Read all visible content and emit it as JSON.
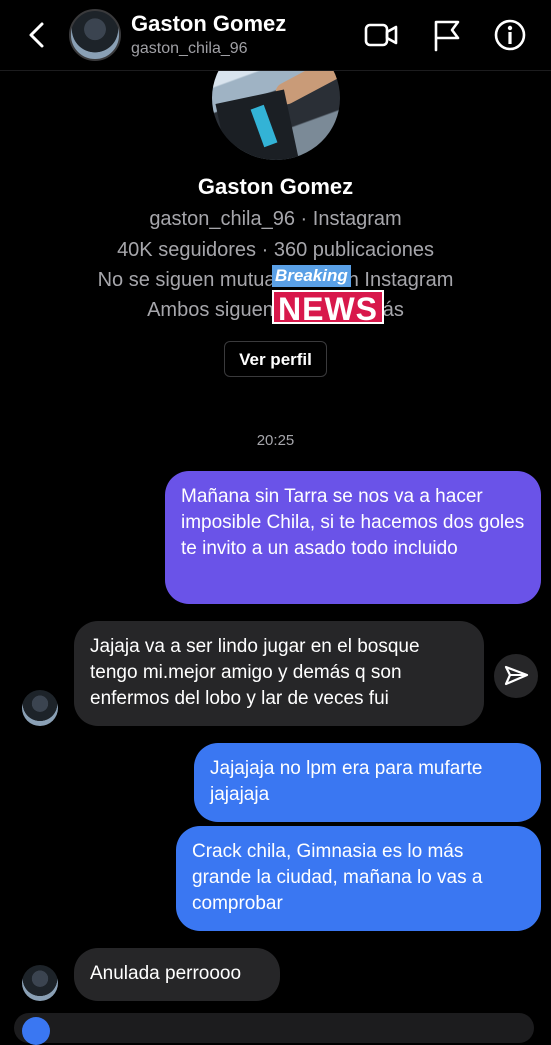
{
  "header": {
    "name": "Gaston Gomez",
    "username": "gaston_chila_96",
    "icons": [
      "back-chevron-icon",
      "video-call-icon",
      "flag-icon",
      "info-icon"
    ]
  },
  "profile": {
    "name": "Gaston Gomez",
    "account_line": "gaston_chila_96 · Instagram",
    "stats_line": "40K seguidores · 360 publicaciones",
    "follow_line": "No se siguen mutuamente en Instagram",
    "mutual_line": "Ambos siguen a di... y 3 más",
    "view_profile_label": "Ver perfil"
  },
  "sticker": {
    "breaking": "Breaking",
    "news": "NEWS"
  },
  "chat": {
    "timestamp": "20:25",
    "messages": [
      {
        "from": "me",
        "text": "Mañana sin Tarra se nos va a hacer imposible Chila, si te hacemos dos goles te invito a un asado todo incluido"
      },
      {
        "from": "them",
        "text": "Jajaja va a ser lindo jugar en el bosque tengo mi.mejor amigo y demás q son enfermos del lobo y lar de veces fui"
      },
      {
        "from": "me",
        "text": "Jajajaja no lpm era para mufarte jajajaja"
      },
      {
        "from": "me",
        "text": "Crack chila, Gimnasia es lo más grande la ciudad, mañana lo vas a comprobar"
      },
      {
        "from": "them",
        "text": "Anulada perroooo"
      }
    ]
  },
  "colors": {
    "background": "#000000",
    "outgoing_purple": "#6a53e8",
    "outgoing_blue": "#3a77f2",
    "incoming": "#262628"
  }
}
